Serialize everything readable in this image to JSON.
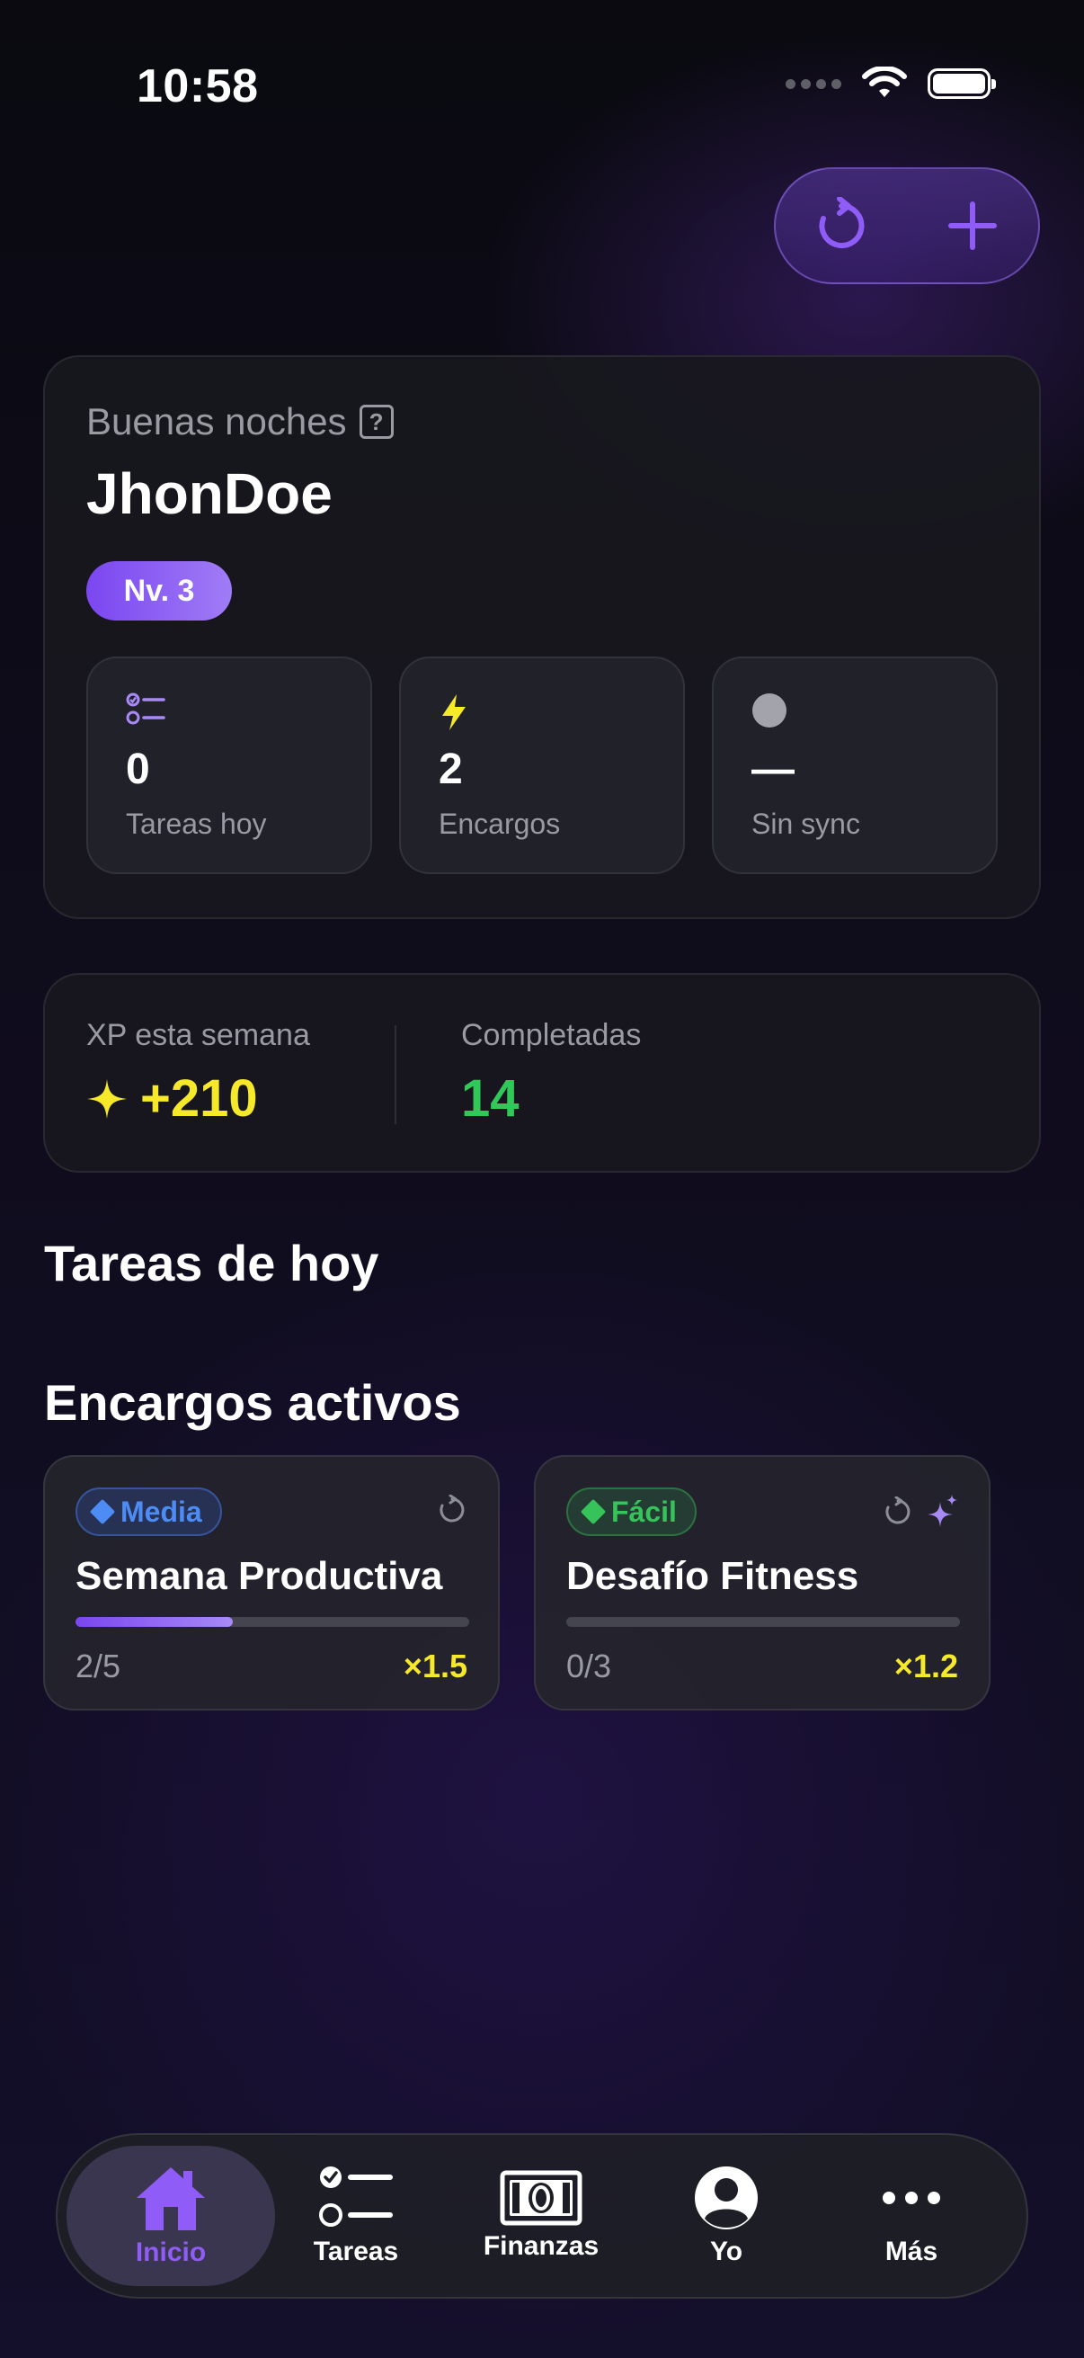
{
  "status_bar": {
    "time": "10:58"
  },
  "greeting": {
    "text": "Buenas noches",
    "help": "?",
    "user_name": "JhonDoe",
    "level": "Nv. 3"
  },
  "stats": [
    {
      "icon": "checklist-icon",
      "value": "0",
      "label": "Tareas hoy"
    },
    {
      "icon": "lightning-icon",
      "value": "2",
      "label": "Encargos"
    },
    {
      "icon": "sync-status-dot-icon",
      "value": "—",
      "label": "Sin sync"
    }
  ],
  "weekly": {
    "xp_label": "XP esta semana",
    "xp_value": "+210",
    "completed_label": "Completadas",
    "completed_value": "14"
  },
  "sections": {
    "today": "Tareas de hoy",
    "active_orders": "Encargos activos"
  },
  "orders": [
    {
      "difficulty": "Media",
      "title": "Semana Productiva",
      "progress_text": "2/5",
      "progress": 0.4,
      "multiplier": "×1.5"
    },
    {
      "difficulty": "Fácil",
      "title": "Desafío Fitness",
      "progress_text": "0/3",
      "progress": 0,
      "multiplier": "×1.2"
    }
  ],
  "nav": [
    {
      "label": "Inicio",
      "icon": "home-icon",
      "active": true
    },
    {
      "label": "Tareas",
      "icon": "checklist-icon"
    },
    {
      "label": "Finanzas",
      "icon": "banknote-icon"
    },
    {
      "label": "Yo",
      "icon": "profile-icon"
    },
    {
      "label": "Más",
      "icon": "more-icon"
    }
  ],
  "colors": {
    "accent": "#8f5cf7",
    "xp": "#f5e92a",
    "success": "#31c85a",
    "medium": "#4d8cf5",
    "easy": "#35c35a"
  }
}
